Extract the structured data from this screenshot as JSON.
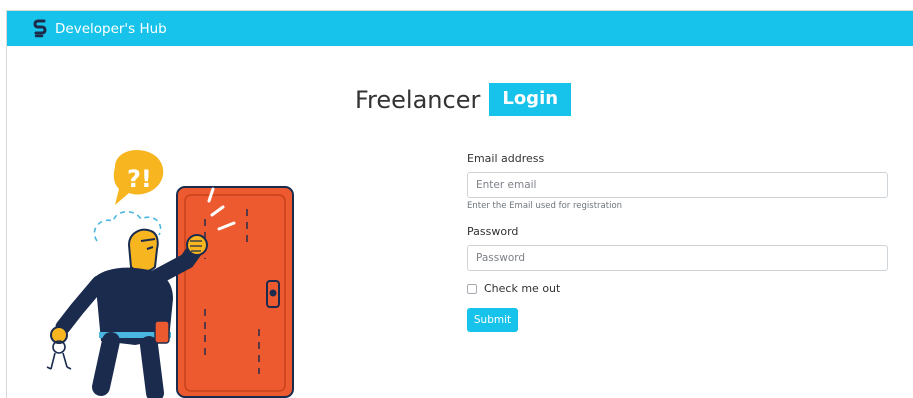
{
  "navbar": {
    "brand_text": "Developer's Hub",
    "logo_icon": "s-logo-icon",
    "color": "#17c3ea"
  },
  "heading": {
    "title": "Freelancer",
    "badge": "Login"
  },
  "illustration": {
    "icon": "locked-out-person-at-door-illustration",
    "speech_bubble_text": "?!"
  },
  "form": {
    "email": {
      "label": "Email address",
      "placeholder": "Enter email",
      "value": "",
      "help": "Enter the Email used for registration"
    },
    "password": {
      "label": "Password",
      "placeholder": "Password",
      "value": ""
    },
    "remember": {
      "label": "Check me out",
      "checked": false
    },
    "submit_label": "Submit"
  },
  "colors": {
    "accent": "#17c3ea",
    "door": "#ee5a2f",
    "person_body": "#1b2b4e",
    "person_skin": "#f7b520"
  }
}
